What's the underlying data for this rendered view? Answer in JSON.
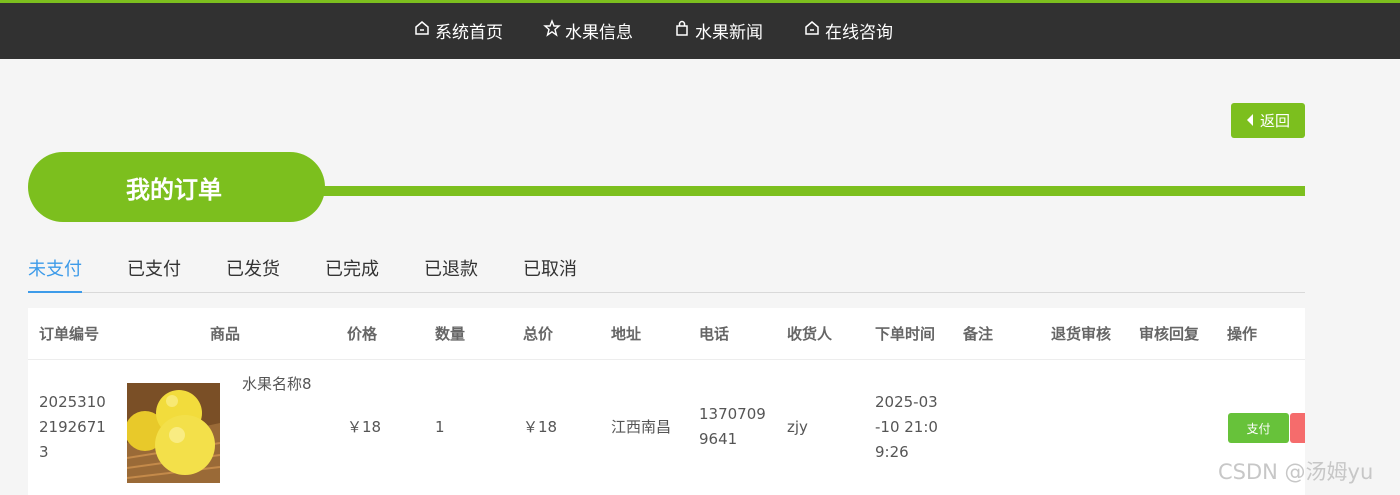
{
  "nav": {
    "items": [
      {
        "label": "系统首页",
        "icon": "home-icon"
      },
      {
        "label": "水果信息",
        "icon": "star-icon"
      },
      {
        "label": "水果新闻",
        "icon": "bag-icon"
      },
      {
        "label": "在线咨询",
        "icon": "home-icon"
      }
    ]
  },
  "back_label": "返回",
  "page_title": "我的订单",
  "tabs": [
    "未支付",
    "已支付",
    "已发货",
    "已完成",
    "已退款",
    "已取消"
  ],
  "active_tab": "未支付",
  "table": {
    "headers": [
      "订单编号",
      "商品",
      "价格",
      "数量",
      "总价",
      "地址",
      "电话",
      "收货人",
      "下单时间",
      "备注",
      "退货审核",
      "审核回复",
      "操作"
    ],
    "rows": [
      {
        "order_no": "20253102192671 3",
        "product_name": "水果名称8",
        "price": "￥18",
        "quantity": "1",
        "total": "￥18",
        "address": "江西南昌",
        "phone": "13707099641",
        "receiver": "zjy",
        "order_time": "2025-03-10 21:09:26",
        "note": "",
        "return_review": "",
        "review_reply": "",
        "pay_label": "支付"
      }
    ]
  },
  "watermark": "CSDN @汤姆yu",
  "colors": {
    "accent": "#7cbf1e",
    "active_tab": "#3d9be9",
    "pay": "#67c23a",
    "danger": "#f56c6c",
    "topbar": "#313131"
  }
}
